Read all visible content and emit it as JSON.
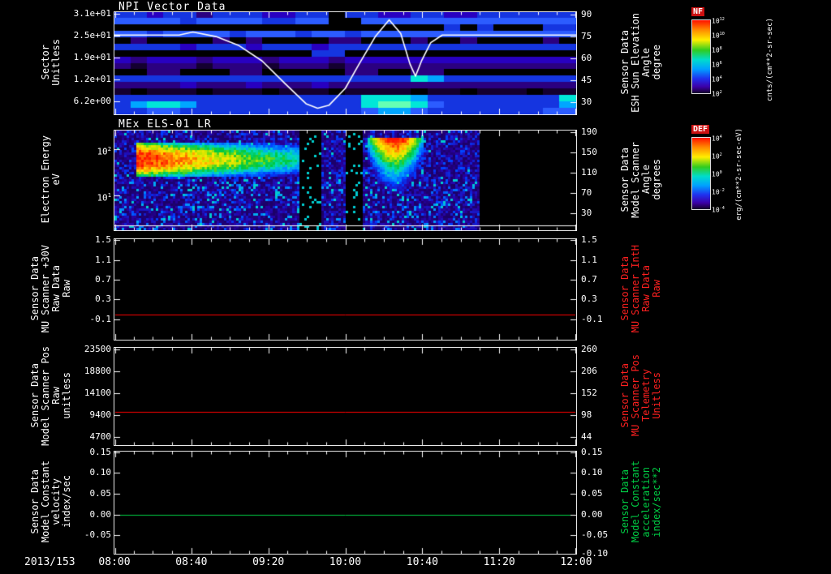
{
  "meta": {
    "window_kind": "multi-panel science time-series plot"
  },
  "chart_data": {
    "type": "heatmap",
    "layout_hint": "5 stacked time panels, shared x axis, black background, white axes",
    "x_axis": {
      "date": "2013/153",
      "ticks": [
        "08:00",
        "08:40",
        "09:20",
        "10:00",
        "10:40",
        "11:20",
        "12:00"
      ]
    },
    "panels": [
      {
        "id": "npi",
        "type": "heatmap",
        "title": "NPI Vector Data",
        "ylabel_left": [
          "Sector",
          "Unitless"
        ],
        "ylabel_right": [
          "Sensor Data",
          "ESH Sun Elevation",
          "Angle",
          "degree"
        ],
        "right_color": "#ffffff",
        "left_ticks": [
          [
            "3.1e+01",
            0.016
          ],
          [
            "2.5e+01",
            0.23
          ],
          [
            "1.9e+01",
            0.444
          ],
          [
            "1.2e+01",
            0.659
          ],
          [
            "6.2e+00",
            0.873
          ]
        ],
        "right_ticks": [
          [
            "90",
            0.024
          ],
          [
            "75",
            0.238
          ],
          [
            "60",
            0.452
          ],
          [
            "45",
            0.667
          ],
          [
            "30",
            0.881
          ]
        ],
        "heatmap": {
          "palette": [
            "#000000",
            "#140030",
            "#2b0080",
            "#2800c0",
            "#1535e0",
            "#2c5cff",
            "#00a6ff",
            "#00e6d8",
            "#64ffb4"
          ],
          "rows": [
            "4434424443344044334433444444",
            "5555455554455005555555555555",
            "0000000000000000000040400044",
            "5545555455545545555555555555",
            "0200002020000220002002000020",
            "4444344434443444444444444444",
            "0000000000004400000000000000",
            "3233323332333233333333333333",
            "2122212221222122222222222222",
            "0022000220000022002200000000",
            "4444444444444444447644444444",
            "2222322232223222222222222222",
            "1011101110111011110110111011",
            "4444444444444447776444444447",
            "4677644444444447887544444446",
            "4455444444444445665444444455"
          ]
        },
        "overlay": {
          "color": "#ffffff",
          "label": "ESH Sun Elevation Angle (degree)",
          "points": [
            [
              0,
              0.224
            ],
            [
              0.14,
              0.224
            ],
            [
              0.17,
              0.194
            ],
            [
              0.22,
              0.239
            ],
            [
              0.27,
              0.328
            ],
            [
              0.32,
              0.478
            ],
            [
              0.37,
              0.701
            ],
            [
              0.415,
              0.896
            ],
            [
              0.44,
              0.94
            ],
            [
              0.465,
              0.91
            ],
            [
              0.5,
              0.746
            ],
            [
              0.53,
              0.507
            ],
            [
              0.565,
              0.239
            ],
            [
              0.595,
              0.075
            ],
            [
              0.62,
              0.209
            ],
            [
              0.64,
              0.507
            ],
            [
              0.652,
              0.627
            ],
            [
              0.665,
              0.478
            ],
            [
              0.685,
              0.299
            ],
            [
              0.71,
              0.224
            ],
            [
              1,
              0.224
            ]
          ]
        }
      },
      {
        "id": "els",
        "type": "spectrogram",
        "title": "MEx ELS-01 LR",
        "ylabel_left": [
          "Electron Energy",
          "eV"
        ],
        "ylabel_right": [
          "Sensor Data",
          "Model Scanner",
          "Angle",
          "degrees"
        ],
        "right_color": "#ffffff",
        "left_ticks": [
          [
            "10^2",
            0.19
          ],
          [
            "10^1",
            0.65
          ]
        ],
        "right_ticks": [
          [
            "190",
            0.016
          ],
          [
            "150",
            0.22
          ],
          [
            "110",
            0.423
          ],
          [
            "70",
            0.626
          ],
          [
            "30",
            0.829
          ]
        ],
        "features": {
          "data_end": 0.79,
          "gaps": [
            [
              0.4,
              0.447
            ],
            [
              0.497,
              0.535
            ]
          ],
          "band": {
            "x0": 0.045,
            "x1": 0.405,
            "y0": 0.1,
            "y1": 0.46
          },
          "blob": {
            "x0": 0.545,
            "x1": 0.665,
            "y0": 0.05,
            "y1": 0.62
          }
        },
        "bottom_line": 0.95
      },
      {
        "id": "mu-scanner-30v",
        "type": "line",
        "title": "",
        "ylabel_left": [
          "Sensor Data",
          "MU Scanner +30V",
          "Raw Data",
          "Raw"
        ],
        "ylabel_right": [
          "Sensor Data",
          "MU Scanner IntH",
          "Raw Data",
          "Raw"
        ],
        "right_color": "#ff2020",
        "left_ticks": [
          [
            "1.5",
            0.012
          ],
          [
            "1.1",
            0.208
          ],
          [
            "0.7",
            0.404
          ],
          [
            "0.3",
            0.6
          ],
          [
            "-0.1",
            0.796
          ]
        ],
        "right_ticks": [
          [
            "1.5",
            0.012
          ],
          [
            "1.1",
            0.208
          ],
          [
            "0.7",
            0.404
          ],
          [
            "0.3",
            0.6
          ],
          [
            "-0.1",
            0.796
          ]
        ],
        "series": [
          {
            "name": "MU Scanner +30V Raw Data",
            "color": "#ff0000",
            "value": 0.0,
            "f": 0.746
          }
        ]
      },
      {
        "id": "scanner-pos",
        "type": "line",
        "title": "",
        "ylabel_left": [
          "Sensor Data",
          "Model Scanner Pos",
          "Raw",
          "unitless"
        ],
        "ylabel_right": [
          "Sensor Data",
          "MU Scanner Pos",
          "Telemetry",
          "Unitless"
        ],
        "right_color": "#ff2020",
        "left_ticks": [
          [
            "23500",
            0.017
          ],
          [
            "18800",
            0.242
          ],
          [
            "14100",
            0.467
          ],
          [
            "9400",
            0.692
          ],
          [
            "4700",
            0.917
          ]
        ],
        "right_ticks": [
          [
            "260",
            0.017
          ],
          [
            "206",
            0.242
          ],
          [
            "152",
            0.467
          ],
          [
            "98",
            0.692
          ],
          [
            "44",
            0.917
          ]
        ],
        "series": [
          {
            "name": "Model Scanner Pos Raw",
            "color": "#ff0000",
            "value": 10100,
            "f": 0.658
          }
        ]
      },
      {
        "id": "model-constant",
        "type": "line",
        "title": "",
        "ylabel_left": [
          "Sensor Data",
          "Model Constant",
          "velocity",
          "index/sec"
        ],
        "ylabel_right": [
          "Sensor Data",
          "Model Constant",
          "acceleration",
          "index/sec**2"
        ],
        "right_color": "#00cc44",
        "left_ticks": [
          [
            "0.15",
            0.008
          ],
          [
            "0.10",
            0.206
          ],
          [
            "0.05",
            0.413
          ],
          [
            "0.00",
            0.619
          ],
          [
            "-0.05",
            0.817
          ]
        ],
        "right_ticks": [
          [
            "0.15",
            0.008
          ],
          [
            "0.10",
            0.206
          ],
          [
            "0.05",
            0.413
          ],
          [
            "0.00",
            0.619
          ],
          [
            "-0.05",
            0.817
          ],
          [
            "-0.10",
            1.0
          ]
        ],
        "series": [
          {
            "name": "Model Constant velocity",
            "color": "#00cc44",
            "value": 0.0,
            "f": 0.619
          }
        ]
      }
    ]
  },
  "colorbars": [
    {
      "label": "NF",
      "units": "cnts/(cm**2-sr-sec)",
      "ticks": [
        "10^12",
        "10^10",
        "10^8",
        "10^6",
        "10^4",
        "10^2"
      ]
    },
    {
      "label": "DEF",
      "units": "erg/(cm**2-sr-sec-eV)",
      "ticks": [
        "10^4",
        "10^2",
        "10^0",
        "10^-2",
        "10^-4"
      ]
    }
  ]
}
